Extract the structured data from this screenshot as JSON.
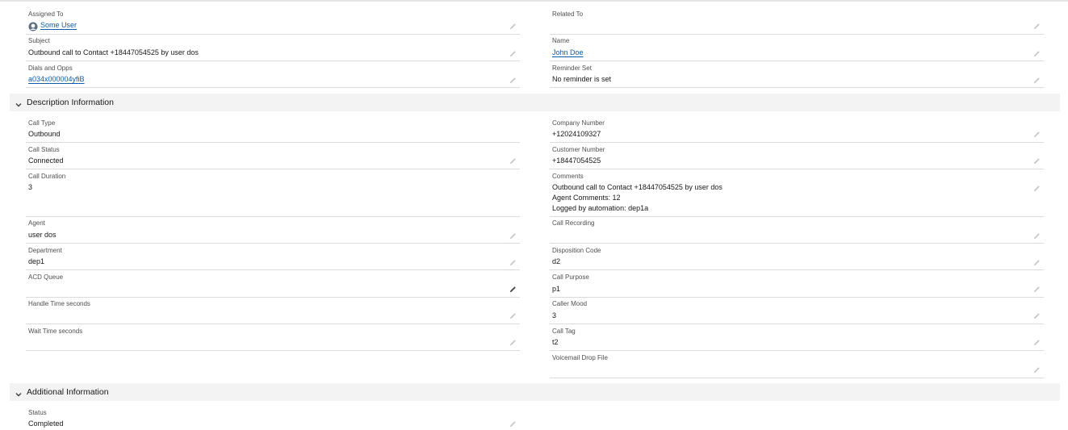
{
  "top_fields": {
    "assigned_to": {
      "label": "Assigned To",
      "value": "Some User"
    },
    "related_to": {
      "label": "Related To",
      "value": ""
    },
    "subject": {
      "label": "Subject",
      "value": "Outbound call to Contact +18447054525 by user dos"
    },
    "name": {
      "label": "Name",
      "value": "John Doe"
    },
    "dials_opps": {
      "label": "Dials and Opps",
      "value": "a034x000004yfiB"
    },
    "reminder_set": {
      "label": "Reminder Set",
      "value": "No reminder is set"
    }
  },
  "description_section": {
    "title": "Description Information",
    "call_type": {
      "label": "Call Type",
      "value": "Outbound"
    },
    "company_number": {
      "label": "Company Number",
      "value": "+12024109327"
    },
    "call_status": {
      "label": "Call Status",
      "value": "Connected"
    },
    "customer_number": {
      "label": "Customer Number",
      "value": "+18447054525"
    },
    "call_duration": {
      "label": "Call Duration",
      "value": "3"
    },
    "comments": {
      "label": "Comments",
      "lines": [
        "Outbound call to Contact +18447054525 by user dos",
        "Agent Comments: 12",
        "Logged by automation: dep1a"
      ]
    },
    "agent": {
      "label": "Agent",
      "value": "user dos"
    },
    "call_recording": {
      "label": "Call Recording",
      "value": ""
    },
    "department": {
      "label": "Department",
      "value": "dep1"
    },
    "disposition_code": {
      "label": "Disposition Code",
      "value": "d2"
    },
    "acd_queue": {
      "label": "ACD Queue",
      "value": ""
    },
    "call_purpose": {
      "label": "Call Purpose",
      "value": "p1"
    },
    "handle_time": {
      "label": "Handle Time seconds",
      "value": ""
    },
    "caller_mood": {
      "label": "Caller Mood",
      "value": "3"
    },
    "wait_time": {
      "label": "Wait Time seconds",
      "value": ""
    },
    "call_tag": {
      "label": "Call Tag",
      "value": "t2"
    },
    "voicemail_drop": {
      "label": "Voicemail Drop File",
      "value": ""
    }
  },
  "additional_section": {
    "title": "Additional Information",
    "status": {
      "label": "Status",
      "value": "Completed"
    }
  },
  "colors": {
    "link": "#0b5cab",
    "label": "#514f4d",
    "section_bg": "#f3f3f3",
    "divider": "#dddbda",
    "pencil": "#c9c7c5"
  },
  "icons": {
    "edit": "pencil-icon",
    "section_toggle": "chevron-down-icon",
    "user": "user-avatar-icon"
  }
}
